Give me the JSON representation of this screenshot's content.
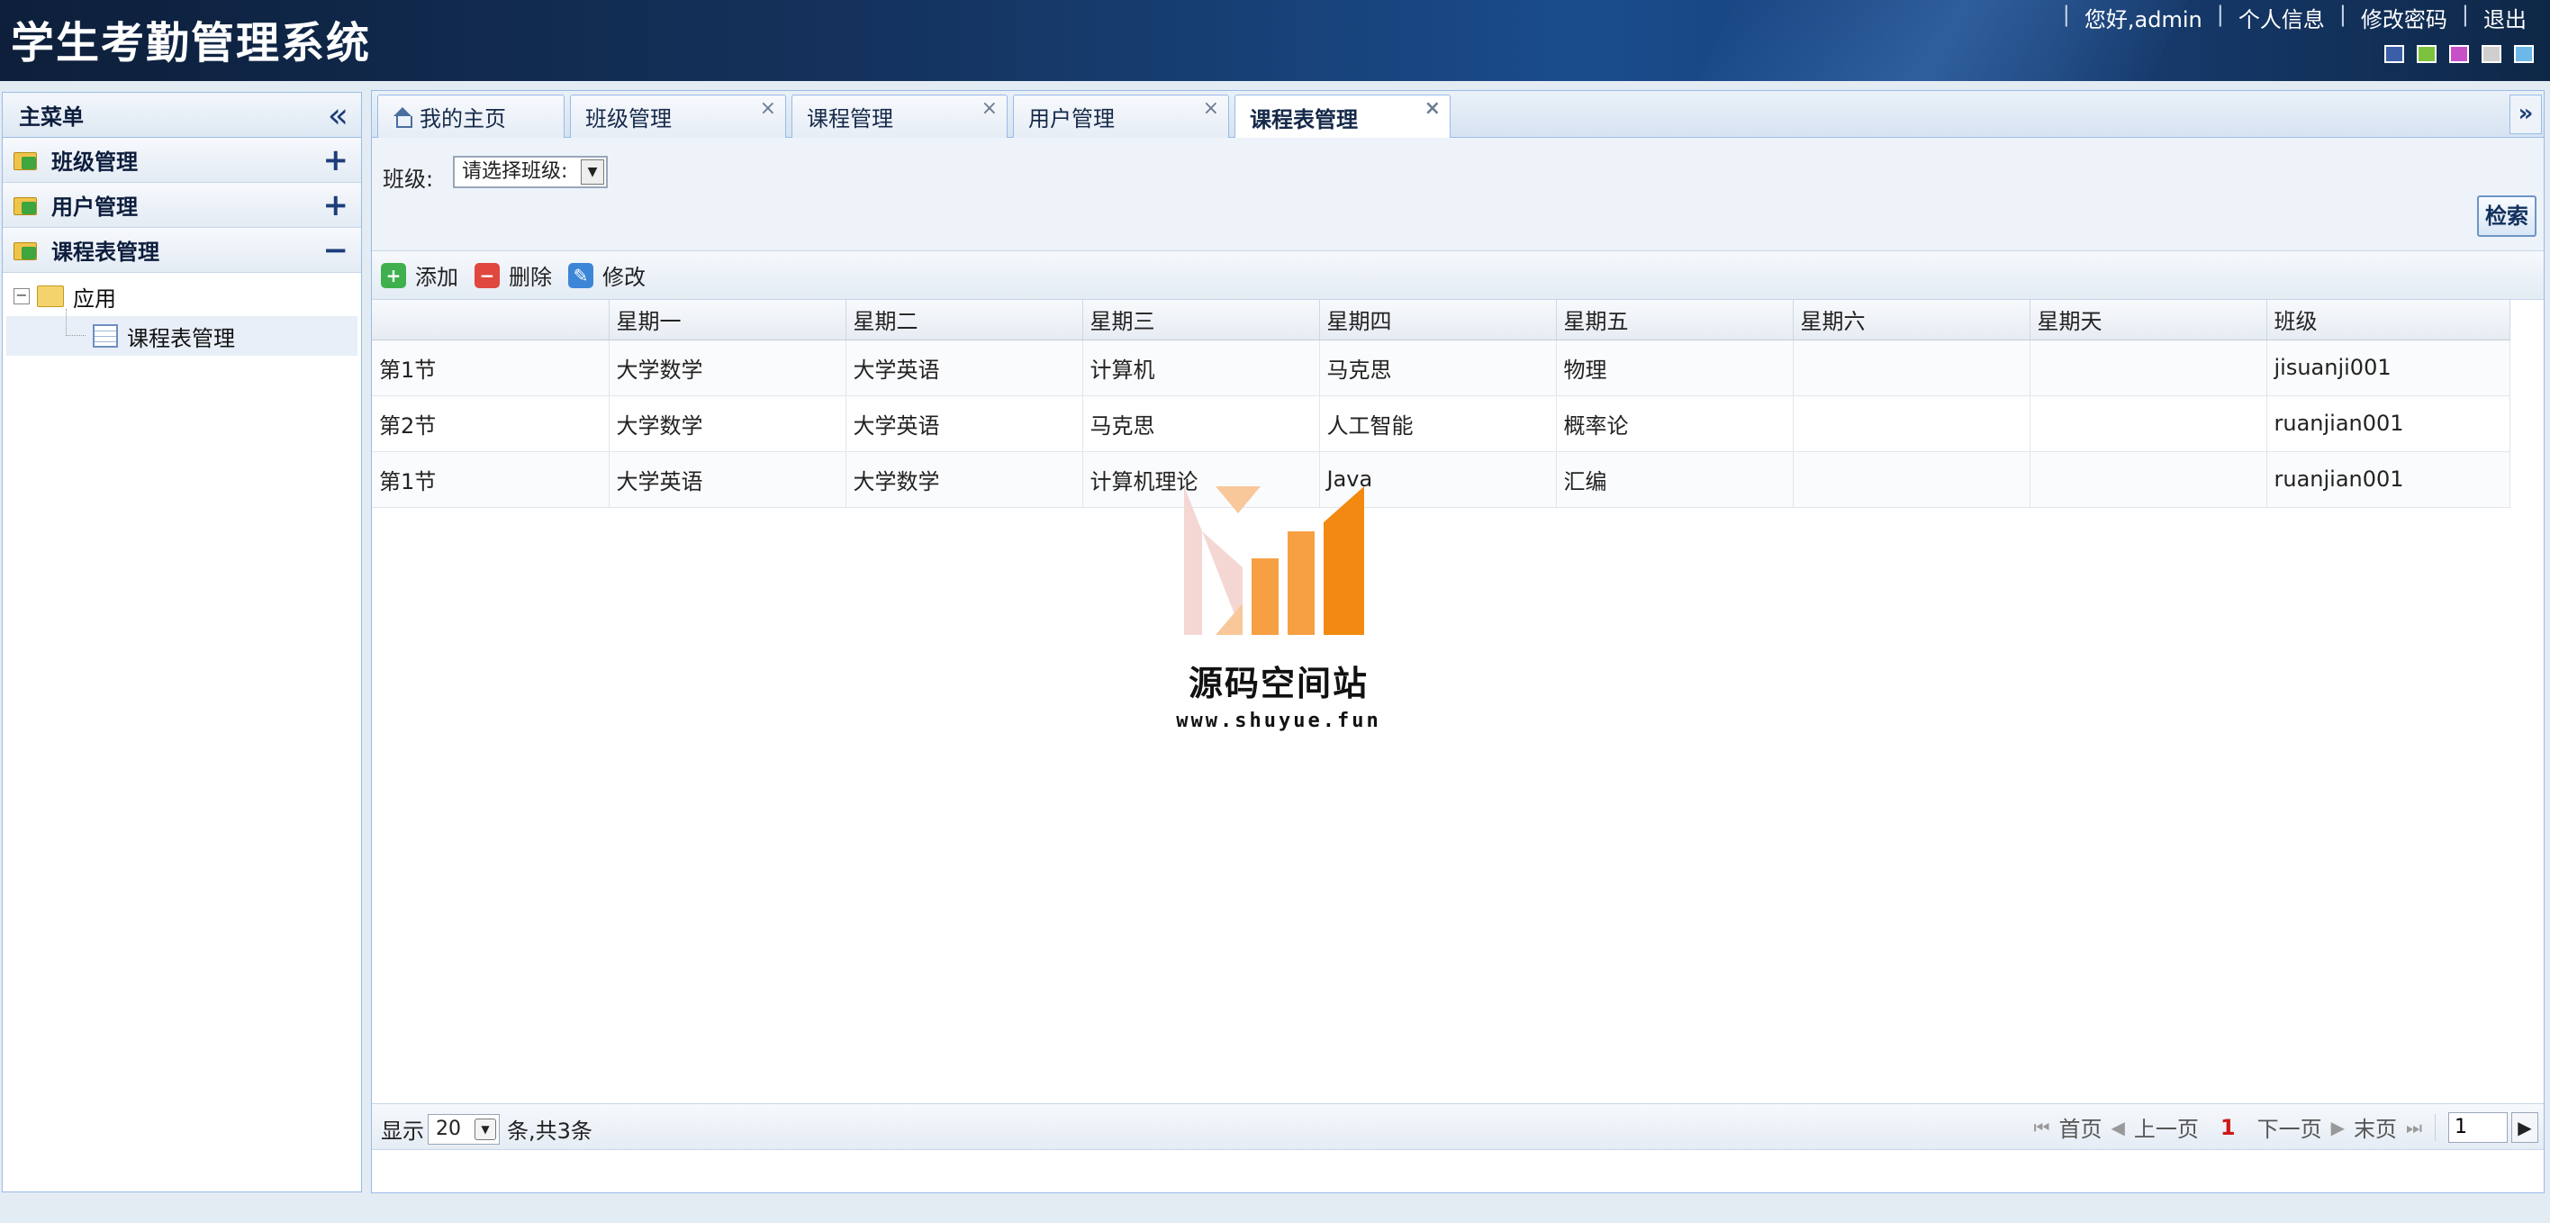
{
  "header": {
    "title": "学生考勤管理系统",
    "links": [
      "您好,admin",
      "个人信息",
      "修改密码",
      "退出"
    ],
    "separator": "|",
    "theme_colors": [
      "#3a5fa8",
      "#7dc23c",
      "#c94fc9",
      "#cfcfcf",
      "#6cb8e8"
    ]
  },
  "sidebar": {
    "title": "主菜单",
    "groups": [
      {
        "label": "班级管理",
        "toggle": "+"
      },
      {
        "label": "用户管理",
        "toggle": "+"
      },
      {
        "label": "课程表管理",
        "toggle": "−"
      }
    ],
    "tree": {
      "root_expander": "−",
      "root_label": "应用",
      "leaf_label": "课程表管理"
    }
  },
  "tabs": [
    {
      "label": "我的主页",
      "closable": false
    },
    {
      "label": "班级管理",
      "closable": true
    },
    {
      "label": "课程管理",
      "closable": true
    },
    {
      "label": "用户管理",
      "closable": true
    },
    {
      "label": "课程表管理",
      "closable": true,
      "active": true
    }
  ],
  "tab_close_glyph": "×",
  "search": {
    "class_label": "班级:",
    "class_select_value": "请选择班级:",
    "search_button": "检索"
  },
  "toolbar": {
    "add": "添加",
    "delete": "删除",
    "edit": "修改"
  },
  "table": {
    "columns": [
      "",
      "星期一",
      "星期二",
      "星期三",
      "星期四",
      "星期五",
      "星期六",
      "星期天",
      "班级"
    ],
    "rows": [
      [
        "第1节",
        "大学数学",
        "大学英语",
        "计算机",
        "马克思",
        "物理",
        "",
        "",
        "jisuanji001"
      ],
      [
        "第2节",
        "大学数学",
        "大学英语",
        "马克思",
        "人工智能",
        "概率论",
        "",
        "",
        "ruanjian001"
      ],
      [
        "第1节",
        "大学英语",
        "大学数学",
        "计算机理论",
        "Java",
        "汇编",
        "",
        "",
        "ruanjian001"
      ]
    ]
  },
  "watermark": {
    "name": "源码空间站",
    "url": "www.shuyue.fun",
    "colors": [
      "#f4d7d3",
      "#f8c79a",
      "#f6a043",
      "#f28a12"
    ]
  },
  "pager": {
    "show_label": "显示",
    "page_size": "20",
    "total_text": "条,共3条",
    "first": "首页",
    "prev": "上一页",
    "current_page": "1",
    "next": "下一页",
    "last": "末页",
    "page_input": "1"
  }
}
